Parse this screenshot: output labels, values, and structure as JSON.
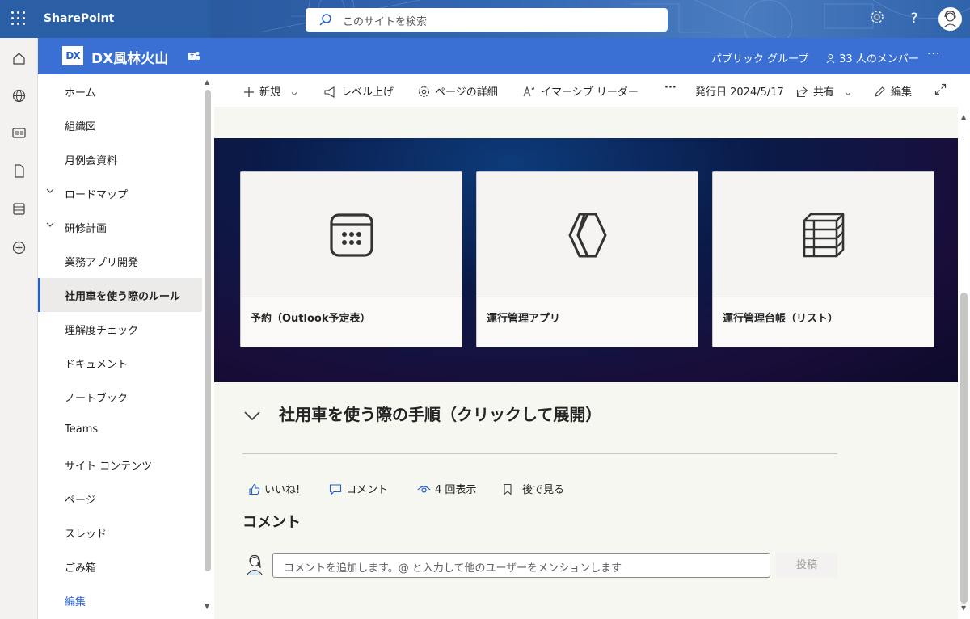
{
  "suite": {
    "brand": "SharePoint",
    "search_placeholder": "このサイトを検索",
    "settings_icon": "gear-icon",
    "help_icon": "?"
  },
  "site": {
    "logo_text": "DX",
    "title": "DX風林火山",
    "group_type": "パブリック グループ",
    "members": "33 人のメンバー",
    "more": "···"
  },
  "nav": {
    "items": [
      {
        "label": "ホーム"
      },
      {
        "label": "組織図"
      },
      {
        "label": "月例会資料"
      },
      {
        "label": "ロードマップ"
      },
      {
        "label": "研修計画"
      },
      {
        "label": "業務アプリ開発"
      },
      {
        "label": "社用車を使う際のルール"
      },
      {
        "label": "理解度チェック"
      },
      {
        "label": "ドキュメント"
      },
      {
        "label": "ノートブック"
      },
      {
        "label": "Teams"
      },
      {
        "label": "サイト コンテンツ"
      },
      {
        "label": "ページ"
      },
      {
        "label": "スレッド"
      },
      {
        "label": "ごみ箱"
      },
      {
        "label": "編集"
      }
    ]
  },
  "commands": {
    "new": "新規",
    "promote": "レベル上げ",
    "page_details": "ページの詳細",
    "immersive_reader": "イマーシブ リーダー",
    "more": "···",
    "published": "発行日 2024/5/17",
    "share": "共有",
    "edit": "編集"
  },
  "hero": {
    "cards": [
      {
        "label": "予約（Outlook予定表）",
        "icon": "calendar-icon"
      },
      {
        "label": "運行管理アプリ",
        "icon": "power-apps-icon"
      },
      {
        "label": "運行管理台帳（リスト）",
        "icon": "list-icon"
      }
    ]
  },
  "section": {
    "title": "社用車を使う際の手順（クリックして展開）"
  },
  "social": {
    "like": "いいね!",
    "comment": "コメント",
    "views": "4 回表示",
    "save_later": "後で見る"
  },
  "comments": {
    "heading": "コメント",
    "placeholder": "コメントを追加します。@ と入力して他のユーザーをメンションします",
    "post": "投稿"
  }
}
